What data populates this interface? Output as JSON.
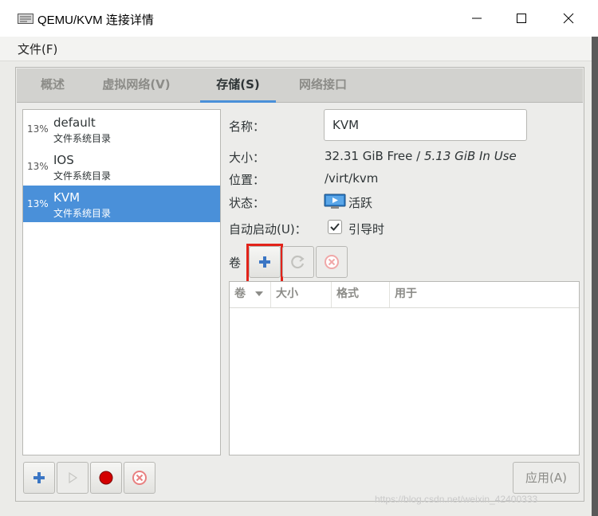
{
  "window": {
    "title": "QEMU/KVM 连接详情"
  },
  "menu": {
    "file": "文件(F)"
  },
  "tabs": [
    {
      "label": "概述"
    },
    {
      "label": "虚拟网络(V)"
    },
    {
      "label": "存储(S)"
    },
    {
      "label": "网络接口"
    }
  ],
  "active_tab": 2,
  "pools": [
    {
      "percent": "13%",
      "name": "default",
      "type": "文件系统目录"
    },
    {
      "percent": "13%",
      "name": "IOS",
      "type": "文件系统目录"
    },
    {
      "percent": "13%",
      "name": "KVM",
      "type": "文件系统目录"
    }
  ],
  "selected_pool": 2,
  "details": {
    "name_label": "名称：",
    "name_value": "KVM",
    "size_label": "大小：",
    "size_free": "32.31 GiB Free / ",
    "size_in_use": "5.13 GiB In Use",
    "location_label": "位置：",
    "location_value": "/virt/kvm",
    "state_label": "状态：",
    "state_value": "活跃",
    "autostart_label": "自动启动(U)：",
    "autostart_value": "引导时",
    "autostart_checked": true,
    "volumes_label": "卷"
  },
  "volume_table": {
    "columns": [
      "卷",
      "大小",
      "格式",
      "用于"
    ]
  },
  "apply_label": "应用(A)",
  "watermark": "https://blog.csdn.net/weixin_42400333",
  "colors": {
    "accent": "#4a90d9",
    "highlight": "#e2231a",
    "record": "#d40000",
    "delete": "#e88080"
  },
  "icons": {
    "app": "monitor-icon",
    "add": "plus-icon",
    "refresh": "refresh-icon",
    "delete": "delete-icon",
    "play": "play-icon",
    "stop": "record-icon",
    "state": "monitor-play-icon",
    "sort": "chevron-down-icon"
  }
}
